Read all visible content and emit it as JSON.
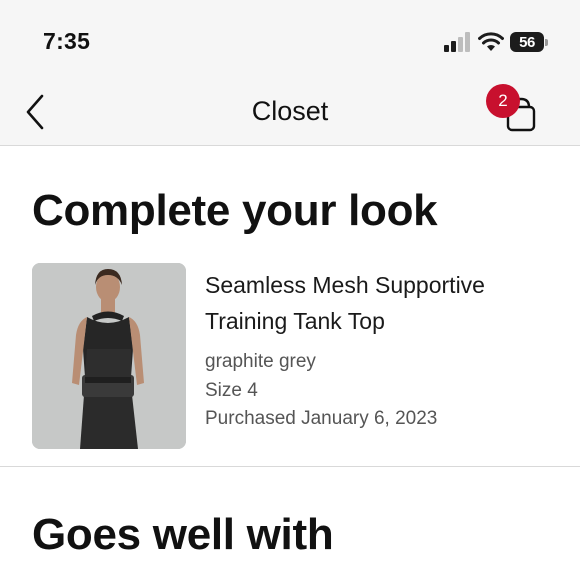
{
  "status_bar": {
    "time": "7:35",
    "battery_level": "56",
    "icons": [
      "signal-icon",
      "wifi-icon",
      "battery-icon"
    ]
  },
  "nav": {
    "title": "Closet",
    "back_icon": "chevron-left-icon",
    "bag_icon": "shopping-bag-icon",
    "bag_count": "2"
  },
  "sections": {
    "complete_title": "Complete your look",
    "goes_title": "Goes well with"
  },
  "product": {
    "name": "Seamless Mesh Supportive Training Tank Top",
    "color": "graphite grey",
    "size": "Size 4",
    "purchased": "Purchased January 6, 2023",
    "image_icon": "product-photo"
  },
  "colors": {
    "badge": "#c8102e",
    "header_bg": "#f6f6f6",
    "text_primary": "#111111",
    "text_secondary": "#555555"
  }
}
